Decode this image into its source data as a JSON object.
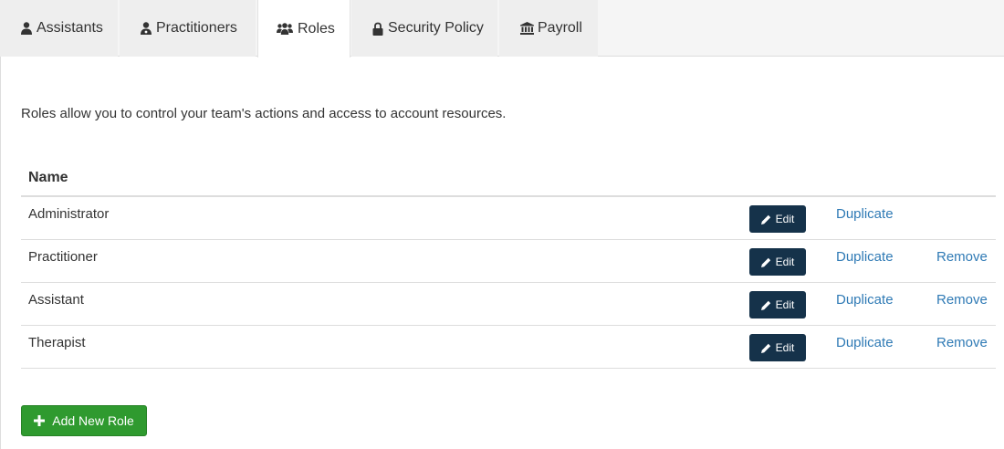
{
  "tabs": [
    {
      "label": "Assistants",
      "icon": "user-icon"
    },
    {
      "label": "Practitioners",
      "icon": "user-md-icon"
    },
    {
      "label": "Roles",
      "icon": "users-icon",
      "active": true
    },
    {
      "label": "Security Policy",
      "icon": "lock-icon"
    },
    {
      "label": "Payroll",
      "icon": "bank-icon"
    }
  ],
  "intro": "Roles allow you to control your team's actions and access to account resources.",
  "table": {
    "header": "Name",
    "rows": [
      {
        "name": "Administrator",
        "edit": "Edit",
        "duplicate": "Duplicate",
        "remove": ""
      },
      {
        "name": "Practitioner",
        "edit": "Edit",
        "duplicate": "Duplicate",
        "remove": "Remove"
      },
      {
        "name": "Assistant",
        "edit": "Edit",
        "duplicate": "Duplicate",
        "remove": "Remove"
      },
      {
        "name": "Therapist",
        "edit": "Edit",
        "duplicate": "Duplicate",
        "remove": "Remove"
      }
    ]
  },
  "add_button": "Add New Role",
  "colors": {
    "edit_button": "#15324a",
    "link": "#2f7ab5",
    "add_button": "#2f9a2f"
  }
}
